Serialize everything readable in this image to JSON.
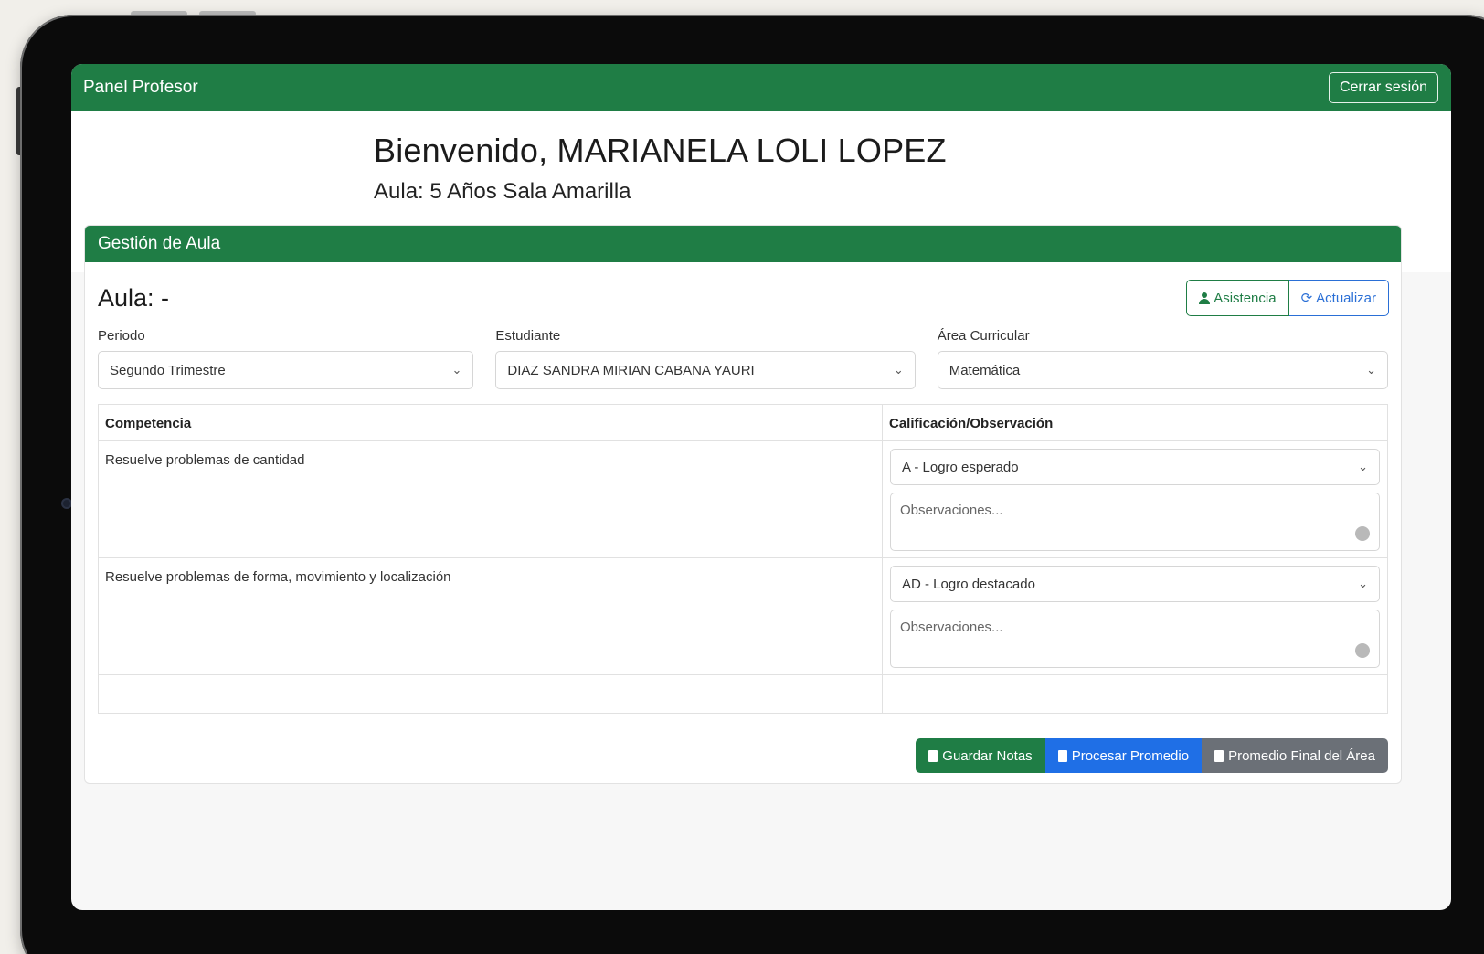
{
  "navbar": {
    "brand": "Panel Profesor",
    "logout_label": "Cerrar sesión"
  },
  "welcome": {
    "title": "Bienvenido, MARIANELA LOLI LOPEZ",
    "aula": "Aula: 5 Años Sala Amarilla"
  },
  "card": {
    "header": "Gestión de Aula",
    "aula_title": "Aula: -",
    "buttons": {
      "asistencia": "Asistencia",
      "actualizar": "Actualizar"
    },
    "filters": [
      {
        "label": "Periodo",
        "value": "Segundo Trimestre"
      },
      {
        "label": "Estudiante",
        "value": "DIAZ SANDRA MIRIAN CABANA YAURI"
      },
      {
        "label": "Área Curricular",
        "value": "Matemática"
      }
    ],
    "table": {
      "headers": [
        "Competencia",
        "Calificación/Observación"
      ],
      "rows": [
        {
          "competencia": "Resuelve problemas de cantidad",
          "grade": "A - Logro esperado",
          "obs_placeholder": "Observaciones..."
        },
        {
          "competencia": "Resuelve problemas de forma, movimiento y localización",
          "grade": "AD - Logro destacado",
          "obs_placeholder": "Observaciones..."
        }
      ]
    },
    "actions": {
      "guardar": "Guardar Notas",
      "procesar": "Procesar Promedio",
      "promedio_final": "Promedio Final del Área"
    }
  },
  "colors": {
    "primary": "#1f7d45",
    "blue": "#1f6fe6",
    "gray": "#6b7077"
  }
}
